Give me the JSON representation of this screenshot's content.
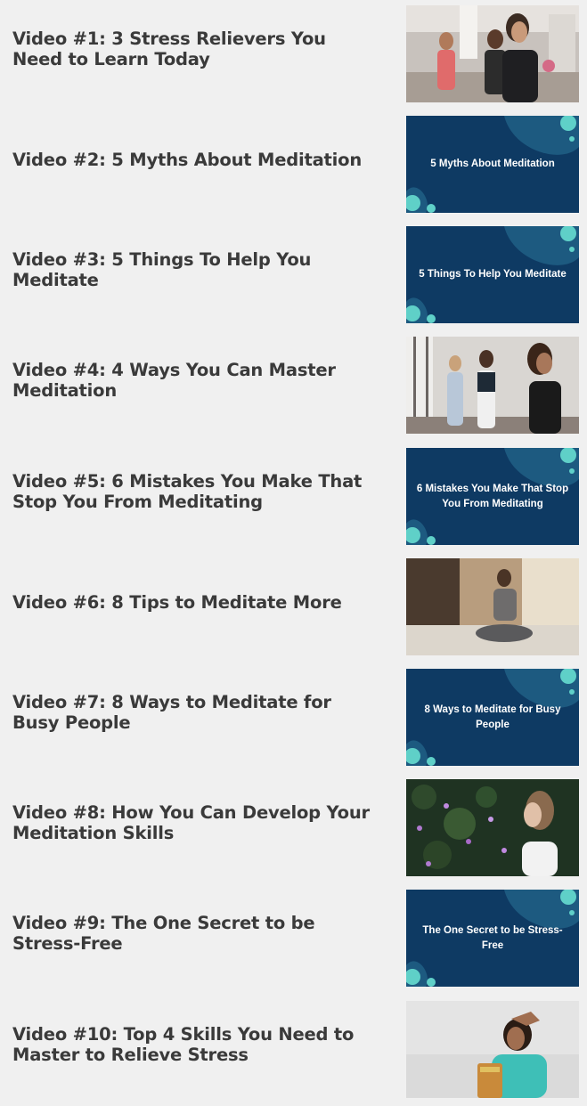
{
  "videos": [
    {
      "title": "Video #1: 3 Stress Relievers You Need to Learn Today",
      "thumbnail": {
        "kind": "photo",
        "subject": "women exercising with dumbbells"
      }
    },
    {
      "title": "Video #2: 5 Myths About Meditation",
      "thumbnail": {
        "kind": "slide",
        "text": "5 Myths About Meditation"
      }
    },
    {
      "title": "Video #3: 5 Things To Help You Meditate",
      "thumbnail": {
        "kind": "slide",
        "text": "5 Things To Help You Meditate"
      }
    },
    {
      "title": "Video #4: 4 Ways You Can Master Meditation",
      "thumbnail": {
        "kind": "photo",
        "subject": "women meditating standing"
      }
    },
    {
      "title": "Video #5: 6 Mistakes You Make That Stop You From Meditating",
      "thumbnail": {
        "kind": "slide",
        "text": "6 Mistakes You Make That Stop You From Meditating"
      }
    },
    {
      "title": "Video #6: 8 Tips to Meditate More",
      "thumbnail": {
        "kind": "photo",
        "subject": "woman meditating on bed"
      }
    },
    {
      "title": "Video #7: 8 Ways to Meditate for Busy People",
      "thumbnail": {
        "kind": "slide",
        "text": "8 Ways to Meditate for Busy People"
      }
    },
    {
      "title": "Video #8: How You Can Develop Your Meditation Skills",
      "thumbnail": {
        "kind": "photo",
        "subject": "woman among flowers looking up"
      }
    },
    {
      "title": "Video #9: The One Secret to be Stress-Free",
      "thumbnail": {
        "kind": "slide",
        "text": "The One Secret to be Stress-Free"
      }
    },
    {
      "title": "Video #10: Top 4 Skills You Need to Master to Relieve Stress",
      "thumbnail": {
        "kind": "photo",
        "subject": "stressed woman holding books"
      }
    }
  ],
  "colors": {
    "background": "#f0f0f0",
    "title_text": "#3a3a3a",
    "slide_background": "#0e3a63",
    "slide_blob": "#1d5a80",
    "slide_dot": "#5fd0c8"
  }
}
